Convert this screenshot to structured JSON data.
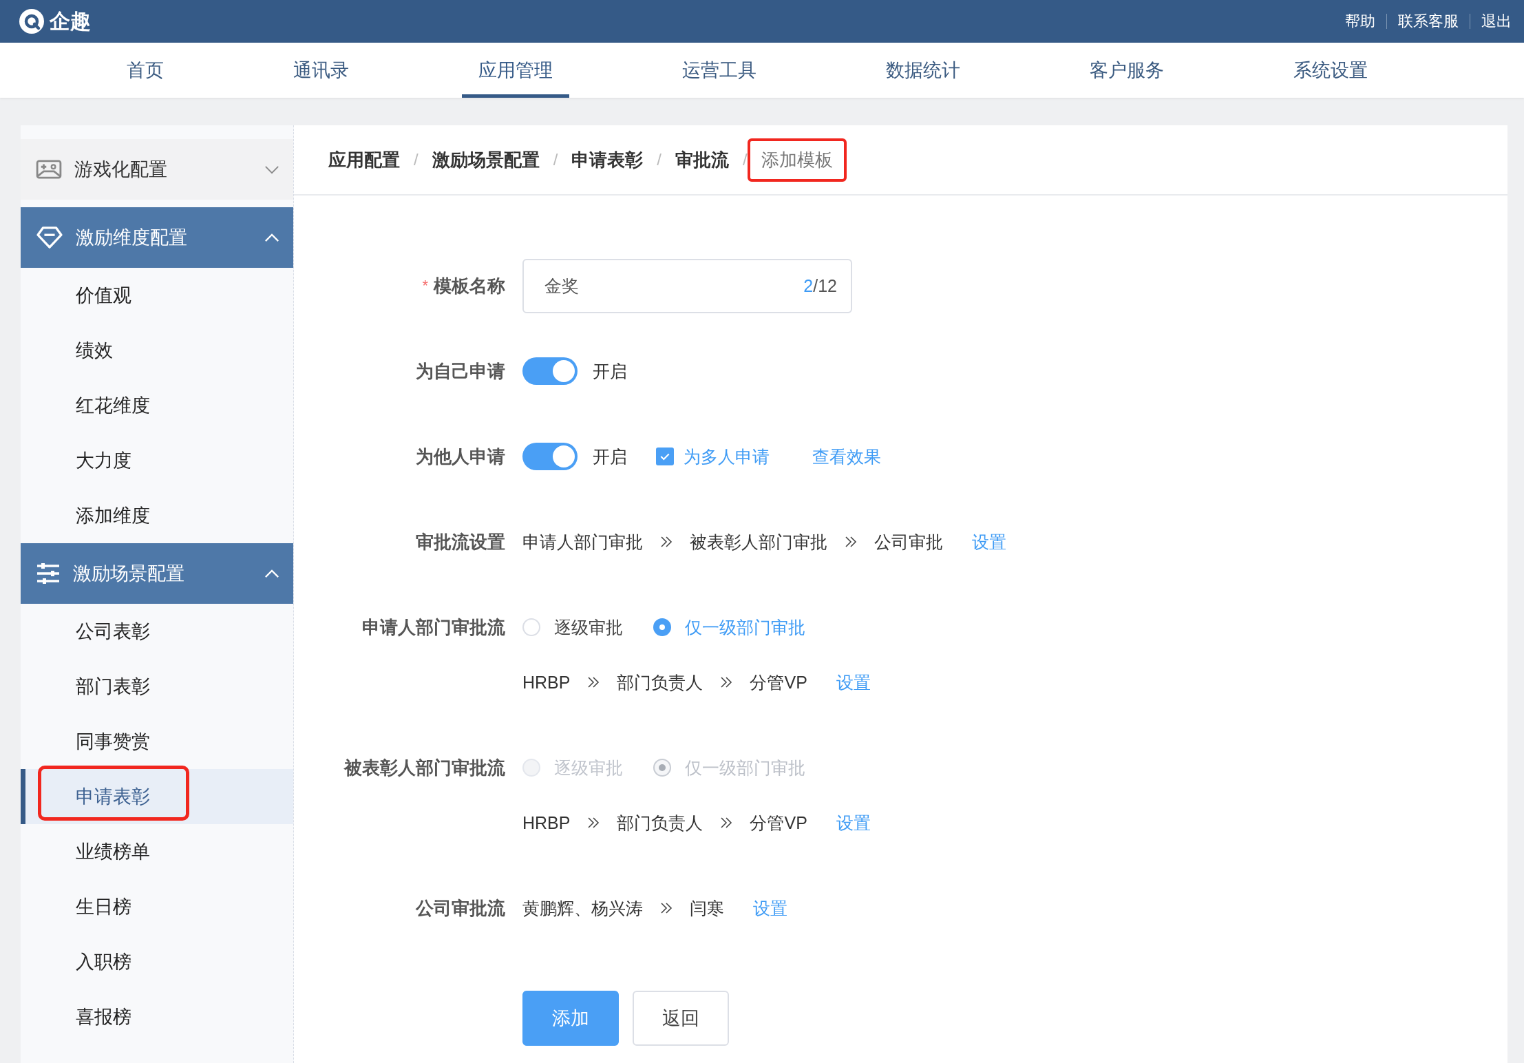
{
  "header": {
    "logo_text": "企趣",
    "links": [
      "帮助",
      "联系客服",
      "退出"
    ]
  },
  "nav": {
    "tabs": [
      {
        "label": "首页",
        "selected": false
      },
      {
        "label": "通讯录",
        "selected": false
      },
      {
        "label": "应用管理",
        "selected": true
      },
      {
        "label": "运营工具",
        "selected": false
      },
      {
        "label": "数据统计",
        "selected": false
      },
      {
        "label": "客户服务",
        "selected": false
      },
      {
        "label": "系统设置",
        "selected": false
      }
    ]
  },
  "sidebar": {
    "groups": [
      {
        "label": "游戏化配置",
        "expanded": false
      },
      {
        "label": "激励维度配置",
        "expanded": true,
        "children": [
          {
            "label": "价值观",
            "selected": false,
            "highlighted": false
          },
          {
            "label": "绩效",
            "selected": false,
            "highlighted": false
          },
          {
            "label": "红花维度",
            "selected": false,
            "highlighted": false
          },
          {
            "label": "大力度",
            "selected": false,
            "highlighted": false
          },
          {
            "label": "添加维度",
            "selected": false,
            "highlighted": false
          }
        ]
      },
      {
        "label": "激励场景配置",
        "expanded": true,
        "children": [
          {
            "label": "公司表彰",
            "selected": false,
            "highlighted": false
          },
          {
            "label": "部门表彰",
            "selected": false,
            "highlighted": false
          },
          {
            "label": "同事赞赏",
            "selected": false,
            "highlighted": false
          },
          {
            "label": "申请表彰",
            "selected": true,
            "highlighted": true
          },
          {
            "label": "业绩榜单",
            "selected": false,
            "highlighted": false
          },
          {
            "label": "生日榜",
            "selected": false,
            "highlighted": false
          },
          {
            "label": "入职榜",
            "selected": false,
            "highlighted": false
          },
          {
            "label": "喜报榜",
            "selected": false,
            "highlighted": false
          }
        ]
      }
    ]
  },
  "breadcrumb": {
    "separator": "/",
    "items": [
      {
        "label": "应用配置",
        "current": false,
        "highlighted": false
      },
      {
        "label": "激励场景配置",
        "current": false,
        "highlighted": false
      },
      {
        "label": "申请表彰",
        "current": false,
        "highlighted": false
      },
      {
        "label": "审批流",
        "current": false,
        "highlighted": false
      },
      {
        "label": "添加模板",
        "current": true,
        "highlighted": true
      }
    ]
  },
  "form": {
    "rows": [
      {
        "kind": "input",
        "label": "模板名称",
        "required_mark": "*",
        "value": "金奖",
        "count": "2",
        "limit": "/12"
      },
      {
        "kind": "toggle",
        "label": "为自己申请",
        "on": true,
        "state_text": "开启"
      },
      {
        "kind": "toggle",
        "label": "为他人申请",
        "on": true,
        "state_text": "开启",
        "checkbox": {
          "label": "为多人申请",
          "checked": true
        },
        "link": "查看效果"
      },
      {
        "kind": "flow",
        "label": "审批流设置",
        "steps": [
          "申请人部门审批",
          "被表彰人部门审批",
          "公司审批"
        ],
        "link": "设置"
      },
      {
        "kind": "radio",
        "label": "申请人部门审批流",
        "disabled": false,
        "options": [
          {
            "label": "逐级审批",
            "selected": false
          },
          {
            "label": "仅一级部门审批",
            "selected": true
          }
        ],
        "steps": [
          "HRBP",
          "部门负责人",
          "分管VP"
        ],
        "link": "设置"
      },
      {
        "kind": "radio",
        "label": "被表彰人部门审批流",
        "disabled": true,
        "options": [
          {
            "label": "逐级审批",
            "selected": false
          },
          {
            "label": "仅一级部门审批",
            "selected": true
          }
        ],
        "steps": [
          "HRBP",
          "部门负责人",
          "分管VP"
        ],
        "link": "设置"
      },
      {
        "kind": "flow",
        "label": "公司审批流",
        "steps": [
          "黄鹏辉、杨兴涛",
          "闫寒"
        ],
        "link": "设置"
      }
    ],
    "buttons": [
      {
        "label": "添加",
        "kind": "primary"
      },
      {
        "label": "返回",
        "kind": "default"
      }
    ]
  }
}
